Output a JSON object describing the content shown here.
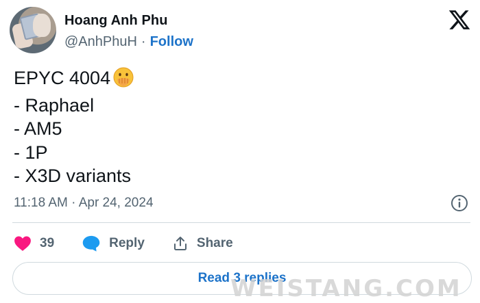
{
  "author": {
    "name": "Hoang Anh Phu",
    "handle": "@AnhPhuH",
    "separator": "·",
    "follow_label": "Follow"
  },
  "tweet": {
    "lines": [
      "EPYC 4004",
      "- Raphael",
      "- AM5",
      "- 1P",
      "- X3D variants"
    ],
    "emoji": "face-with-hand-over-mouth-emoji",
    "timestamp": "11:18 AM · Apr 24, 2024"
  },
  "actions": {
    "like_count": "39",
    "reply_label": "Reply",
    "share_label": "Share"
  },
  "replies_button_label": "Read 3 replies",
  "watermark": "WEISTANG.COM",
  "icons": {
    "logo": "x-logo-icon",
    "info": "info-icon",
    "like": "heart-icon",
    "reply": "chat-bubble-icon",
    "share": "share-icon"
  },
  "colors": {
    "link": "#1d73c9",
    "like": "#f91880",
    "secondary_text": "#536471",
    "divider": "#cfd9de"
  }
}
